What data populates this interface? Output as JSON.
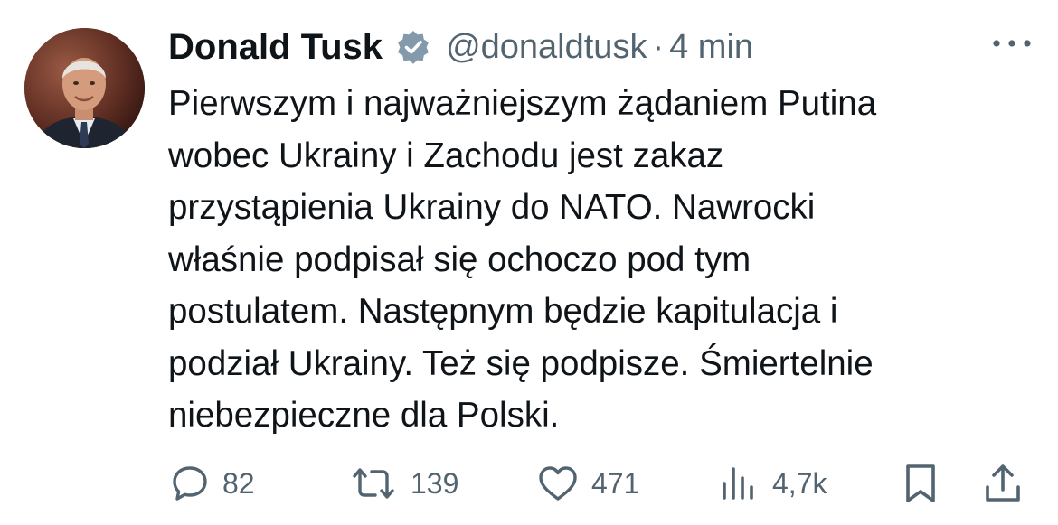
{
  "author": {
    "name": "Donald Tusk",
    "handle": "@donaldtusk",
    "separator": "·",
    "time": "4 min"
  },
  "icons": {
    "verified": "verified-badge-icon",
    "more": "more-options-icon",
    "reply": "reply-icon",
    "retweet": "retweet-icon",
    "like": "like-icon",
    "views": "views-icon",
    "bookmark": "bookmark-icon",
    "share": "share-icon"
  },
  "tweet": {
    "lines": [
      "Pierwszym i najważniejszym żądaniem Putina",
      "wobec Ukrainy i Zachodu jest zakaz",
      "przystąpienia Ukrainy do NATO. Nawrocki",
      "właśnie podpisał się ochoczo pod tym",
      "postulatem. Następnym będzie kapitulacja i",
      "podział Ukrainy. Też się podpisze. Śmiertelnie",
      "niebezpieczne dla Polski."
    ]
  },
  "actions": {
    "replies": "82",
    "retweets": "139",
    "likes": "471",
    "views": "4,7k"
  },
  "colors": {
    "text": "#0f1419",
    "secondary": "#536471",
    "verified": "#829aab"
  }
}
